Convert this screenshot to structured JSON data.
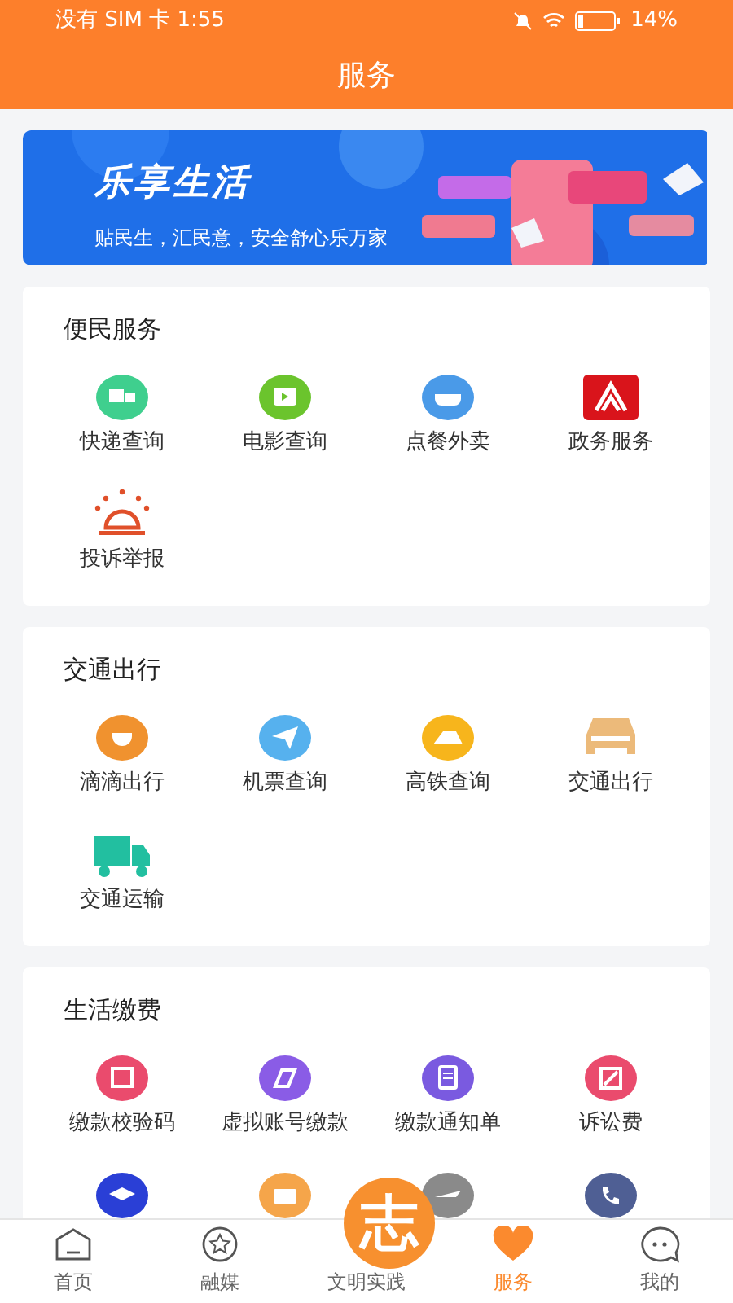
{
  "status_bar": {
    "carrier_time": "没有 SIM 卡 1:55",
    "battery": "14%"
  },
  "header": {
    "title": "服务"
  },
  "banner": {
    "title": "乐享生活",
    "subtitle": "贴民生，汇民意，安全舒心乐万家"
  },
  "sections": [
    {
      "title": "便民服务",
      "items": [
        {
          "label": "快递查询"
        },
        {
          "label": "电影查询"
        },
        {
          "label": "点餐外卖"
        },
        {
          "label": "政务服务"
        },
        {
          "label": "投诉举报"
        }
      ]
    },
    {
      "title": "交通出行",
      "items": [
        {
          "label": "滴滴出行"
        },
        {
          "label": "机票查询"
        },
        {
          "label": "高铁查询"
        },
        {
          "label": "交通出行"
        },
        {
          "label": "交通运输"
        }
      ]
    },
    {
      "title": "生活缴费",
      "items": [
        {
          "label": "缴款校验码"
        },
        {
          "label": "虚拟账号缴款"
        },
        {
          "label": "缴款通知单"
        },
        {
          "label": "诉讼费"
        }
      ]
    }
  ],
  "tab_bar": [
    {
      "label": "首页",
      "selected": false
    },
    {
      "label": "融媒",
      "selected": false
    },
    {
      "label": "文明实践",
      "selected": false,
      "logo": "志"
    },
    {
      "label": "服务",
      "selected": true
    },
    {
      "label": "我的",
      "selected": false
    }
  ]
}
